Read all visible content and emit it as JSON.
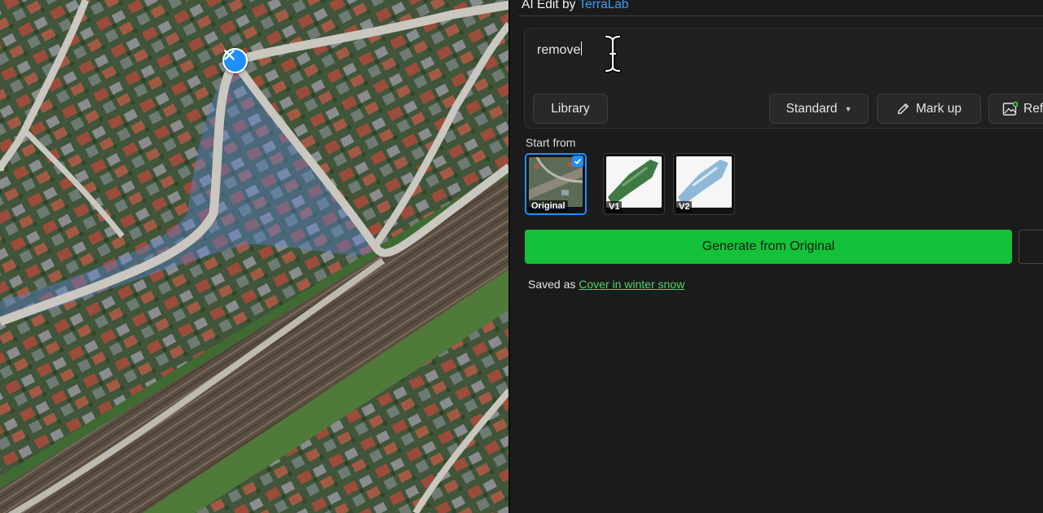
{
  "panel": {
    "title_prefix": "AI Edit by ",
    "title_brand": "TerraLab",
    "prompt_value": "remove"
  },
  "toolbar": {
    "library_label": "Library",
    "standard_label": "Standard",
    "markup_label": "Mark up",
    "refine_label": "Ref"
  },
  "start_from": {
    "label": "Start from",
    "thumbs": [
      {
        "label": "Original",
        "selected": true
      },
      {
        "label": "V1",
        "selected": false
      },
      {
        "label": "V2",
        "selected": false
      }
    ]
  },
  "generate": {
    "label": "Generate from Original"
  },
  "saved": {
    "prefix": "Saved as ",
    "link": "Cover in winter snow"
  },
  "colors": {
    "accent": "#1e8fff",
    "generate": "#14c13a",
    "saved_link": "#4ed46b",
    "panel_bg": "#1b1b1b"
  },
  "icons": [
    "close-icon",
    "text-cursor-icon",
    "chevron-down-icon",
    "pencil-icon",
    "image-refine-icon",
    "checkmark-icon",
    "drag-handle-icon"
  ]
}
